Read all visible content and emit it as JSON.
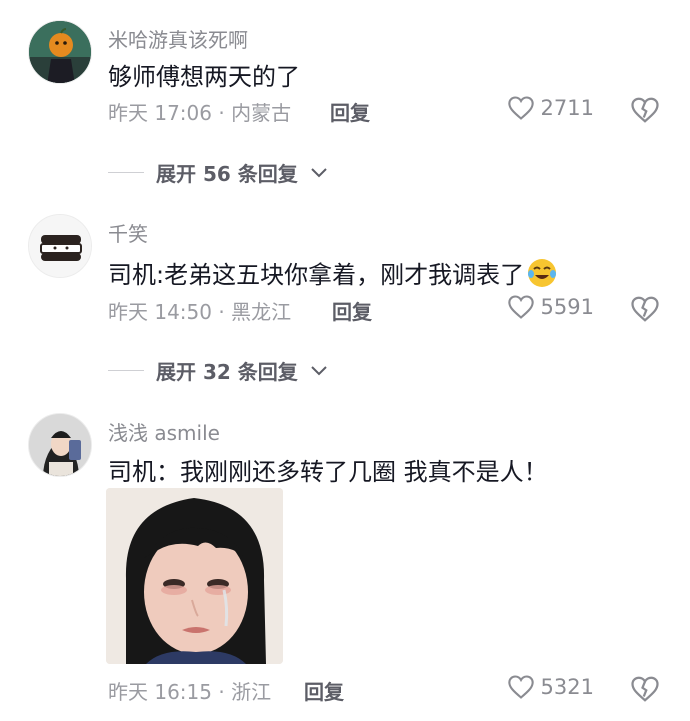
{
  "comments": [
    {
      "username": "米哈游真该死啊",
      "content": "够师傅想两天的了",
      "meta": "昨天 17:06 · 内蒙古",
      "reply_label": "回复",
      "likes": "2711",
      "avatar_icon": "pumpkin-head-character-avatar",
      "expand_label": "展开 56 条回复"
    },
    {
      "username": "千笑",
      "content": "司机:老弟这五块你拿着，刚才我调表了",
      "emoji_icon": "crying-laughing-emoji",
      "meta": "昨天 14:50 · 黑龙江",
      "reply_label": "回复",
      "likes": "5591",
      "avatar_icon": "sandwich-cartoon-avatar",
      "expand_label": "展开 32 条回复"
    },
    {
      "username": "浅浅 asmile",
      "content": "司机：我刚刚还多转了几圈 我真不是人！",
      "meta": "昨天 16:15 · 浙江",
      "reply_label": "回复",
      "likes": "5321",
      "avatar_icon": "girl-selfie-avatar",
      "image_icon": "crying-girl-photo"
    }
  ],
  "colors": {
    "text": "#161823",
    "meta": "#9a9ba1",
    "username": "#8a8b91",
    "reply": "#5c5d66"
  }
}
